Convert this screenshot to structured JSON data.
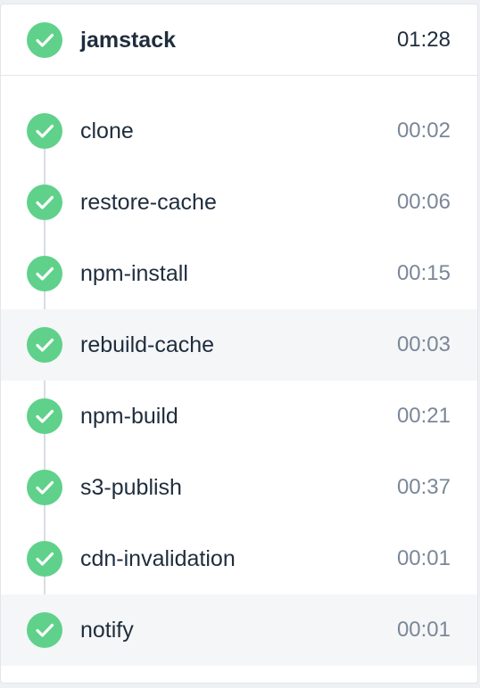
{
  "colors": {
    "success": "#5fd18a",
    "text": "#1f2d3d",
    "muted": "#7b8797",
    "highlight": "#f5f6f8"
  },
  "pipeline": {
    "name": "jamstack",
    "duration": "01:28",
    "status_icon": "check-circle-icon"
  },
  "steps": [
    {
      "label": "clone",
      "duration": "00:02",
      "icon": "check-circle-icon"
    },
    {
      "label": "restore-cache",
      "duration": "00:06",
      "icon": "check-circle-icon"
    },
    {
      "label": "npm-install",
      "duration": "00:15",
      "icon": "check-circle-icon"
    },
    {
      "label": "rebuild-cache",
      "duration": "00:03",
      "icon": "check-circle-icon"
    },
    {
      "label": "npm-build",
      "duration": "00:21",
      "icon": "check-circle-icon"
    },
    {
      "label": "s3-publish",
      "duration": "00:37",
      "icon": "check-circle-icon"
    },
    {
      "label": "cdn-invalidation",
      "duration": "00:01",
      "icon": "check-circle-icon"
    },
    {
      "label": "notify",
      "duration": "00:01",
      "icon": "check-circle-icon"
    }
  ]
}
